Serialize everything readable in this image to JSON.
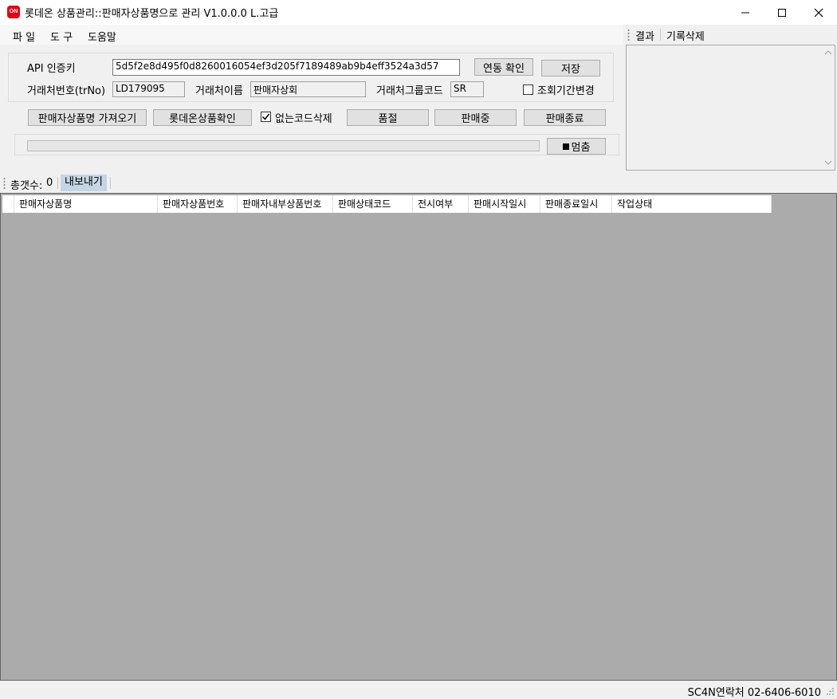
{
  "window": {
    "app_icon_text": "ON",
    "title": "롯데온 상품관리::판매자상품명으로 관리  V1.0.0.0 L.고급"
  },
  "menu": [
    "파 일",
    "도 구",
    "도움말"
  ],
  "result_panel": {
    "tab_result": "결과",
    "tab_clear": "기록삭제"
  },
  "form": {
    "api_key_label": "API 인증키",
    "api_key_value": "5d5f2e8d495f0d8260016054ef3d205f7189489ab9b4eff3524a3d57",
    "link_check_label": "연동 확인",
    "save_label": "저장",
    "trno_label": "거래처번호(trNo)",
    "trno_value": "LD179095",
    "trname_label": "거래처이름",
    "trname_value": "판매자상회",
    "trgroup_label": "거래처그룹코드",
    "trgroup_value": "SR",
    "period_change_label": "조회기간변경",
    "period_change_checked": false
  },
  "actions": {
    "fetch_names": "판매자상품명 가져오기",
    "lotteon_check": "롯데온상품확인",
    "remove_missing_label": "없는코드삭제",
    "remove_missing_checked": true,
    "soldout": "품절",
    "on_sale": "판매중",
    "end_sale": "판매종료",
    "stop": "멈춤",
    "progress": 0
  },
  "summary": {
    "total_label": "총갯수:",
    "total_value": "0",
    "export_label": "내보내기"
  },
  "grid": {
    "columns": [
      "판매자상품명",
      "판매자상품번호",
      "판매자내부상품번호",
      "판매상태코드",
      "전시여부",
      "판매시작일시",
      "판매종료일시",
      "작업상태"
    ]
  },
  "statusbar": {
    "contact": "SC4N연락처 02-6406-6010"
  }
}
